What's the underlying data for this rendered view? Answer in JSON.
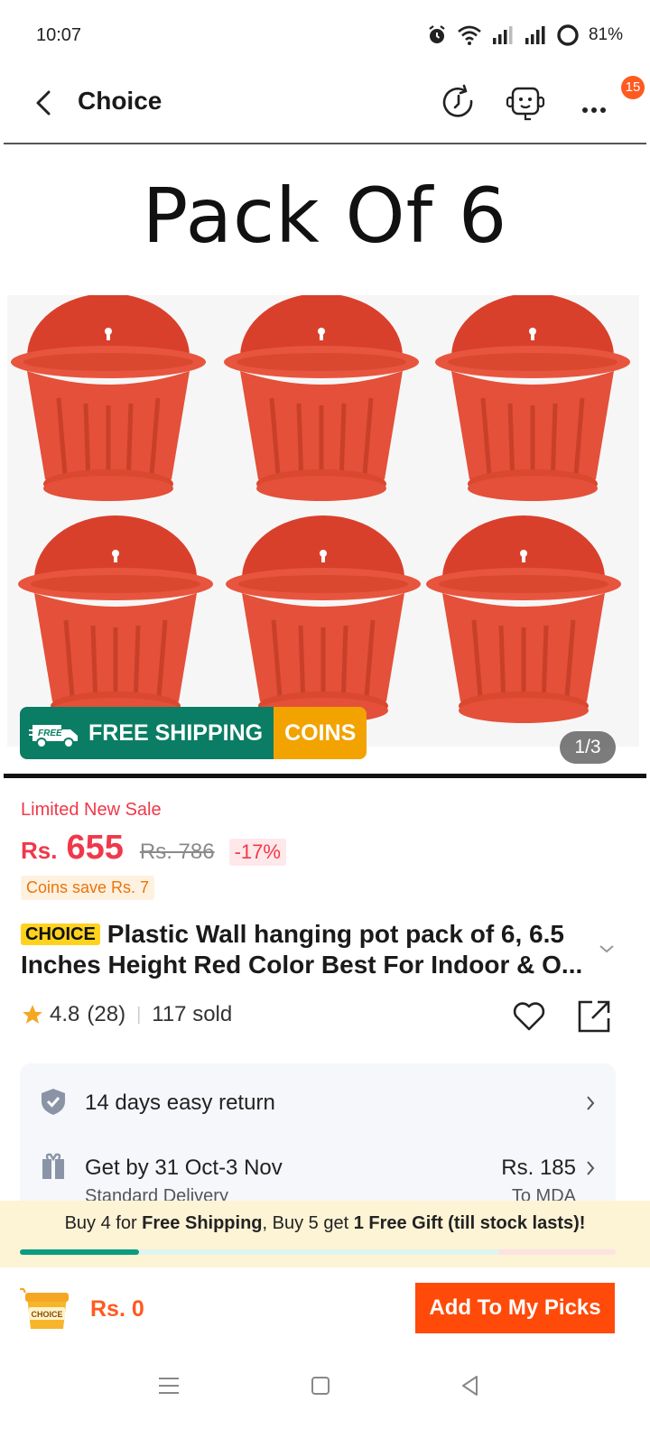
{
  "status_bar": {
    "time": "10:07",
    "battery": "81%",
    "icons": [
      "alarm-icon",
      "wifi-icon",
      "signal-icon",
      "signal-icon",
      "battery-icon"
    ]
  },
  "header": {
    "title": "Choice",
    "icons": [
      "back-icon",
      "history-icon",
      "support-icon",
      "more-icon"
    ],
    "badge": "15"
  },
  "hero": {
    "heading": "Pack Of 6",
    "promo_free": "FREE SHIPPING",
    "promo_free_icon_text": "FREE",
    "promo_coins": "COINS",
    "page_indicator": "1/3"
  },
  "price": {
    "sale_label": "Limited New Sale",
    "currency": "Rs.",
    "value": "655",
    "original": "Rs. 786",
    "discount": "-17%",
    "coins_save": "Coins save Rs. 7"
  },
  "product": {
    "choice_tag": "CHOICE",
    "title": "Plastic Wall hanging pot pack of 6, 6.5 Inches Height Red Color Best For Indoor & O...",
    "rating": "4.8",
    "reviews": "(28)",
    "sold": "117 sold"
  },
  "info": {
    "return_text": "14 days easy return",
    "delivery_text": "Get by 31 Oct-3 Nov",
    "delivery_price": "Rs. 185",
    "delivery_type": "Standard Delivery",
    "delivery_to": "To MDA"
  },
  "shipping_banner": {
    "part1": "Buy 4 for ",
    "bold1": "Free Shipping",
    "part2": ", Buy 5 get ",
    "bold2": "1 Free Gift (till stock lasts)!",
    "progress": 0.2
  },
  "bottom": {
    "cart_label": "CHOICE",
    "total": "Rs. 0",
    "add_button": "Add To My Picks"
  },
  "colors": {
    "accent": "#ff4a0a",
    "price": "#f0384a",
    "free_shipping": "#0a7d64",
    "coins": "#f2a300",
    "pot": "#e8553e"
  }
}
